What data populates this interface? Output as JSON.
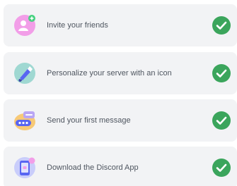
{
  "checklist": {
    "items": [
      {
        "label": "Invite your friends",
        "icon": "invite-friends-icon",
        "done": true
      },
      {
        "label": "Personalize your server with an icon",
        "icon": "server-icon-brush-icon",
        "done": true
      },
      {
        "label": "Send your first message",
        "icon": "message-bubble-icon",
        "done": true
      },
      {
        "label": "Download the Discord App",
        "icon": "phone-app-icon",
        "done": true
      }
    ],
    "colors": {
      "card_bg": "#f2f3f5",
      "text": "#4f5660",
      "check": "#3ba55c"
    }
  }
}
